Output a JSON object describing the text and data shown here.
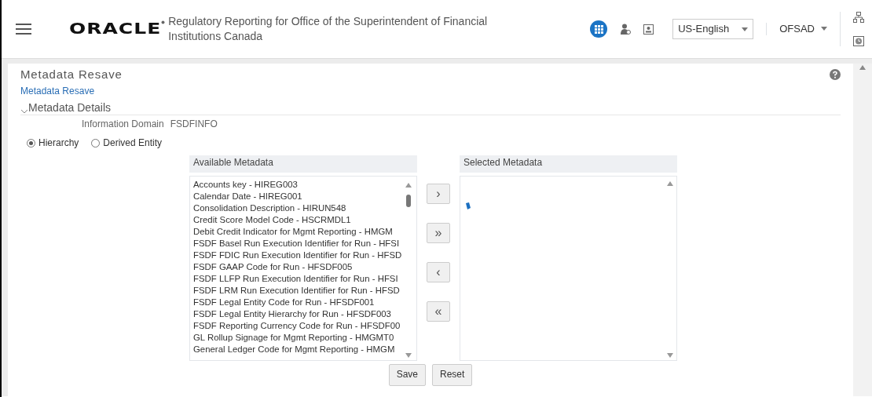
{
  "header": {
    "logo": "ORACLE",
    "title": "Regulatory Reporting for Office of the Superintendent of Financial Institutions Canada",
    "language": "US-English",
    "user": "OFSAD"
  },
  "page": {
    "title": "Metadata Resave",
    "breadcrumb": "Metadata Resave"
  },
  "section": {
    "title": "Metadata Details",
    "expanded": true
  },
  "info": {
    "label": "Information Domain",
    "value": "FSDFINFO"
  },
  "options": [
    {
      "label": "Hierarchy",
      "selected": true
    },
    {
      "label": "Derived Entity",
      "selected": false
    }
  ],
  "available": {
    "title": "Available Metadata",
    "items": [
      "Accounts key - HIREG003",
      "Calendar Date - HIREG001",
      "Consolidation Description - HIRUN548",
      "Credit Score Model Code - HSCRMDL1",
      "Debit Credit Indicator for Mgmt Reporting - HMGM",
      "FSDF Basel Run Execution Identifier for Run - HFSI",
      "FSDF FDIC Run Execution Identifier for Run - HFSD",
      "FSDF GAAP Code for Run - HFSDF005",
      "FSDF LLFP Run Execution Identifier for Run - HFSI",
      "FSDF LRM Run Execution Identifier for Run - HFSD",
      "FSDF Legal Entity Code for Run - HFSDF001",
      "FSDF Legal Entity Hierarchy for Run - HFSDF003",
      "FSDF Reporting Currency Code for Run - HFSDF00",
      "GL Rollup Signage for Mgmt Reporting - HMGMT0",
      "General Ledger Code for Mgmt Reporting - HMGM"
    ]
  },
  "move_buttons": [
    "›",
    "»",
    "‹",
    "«"
  ],
  "selected": {
    "title": "Selected Metadata"
  },
  "buttons": [
    "Save",
    "Reset"
  ]
}
